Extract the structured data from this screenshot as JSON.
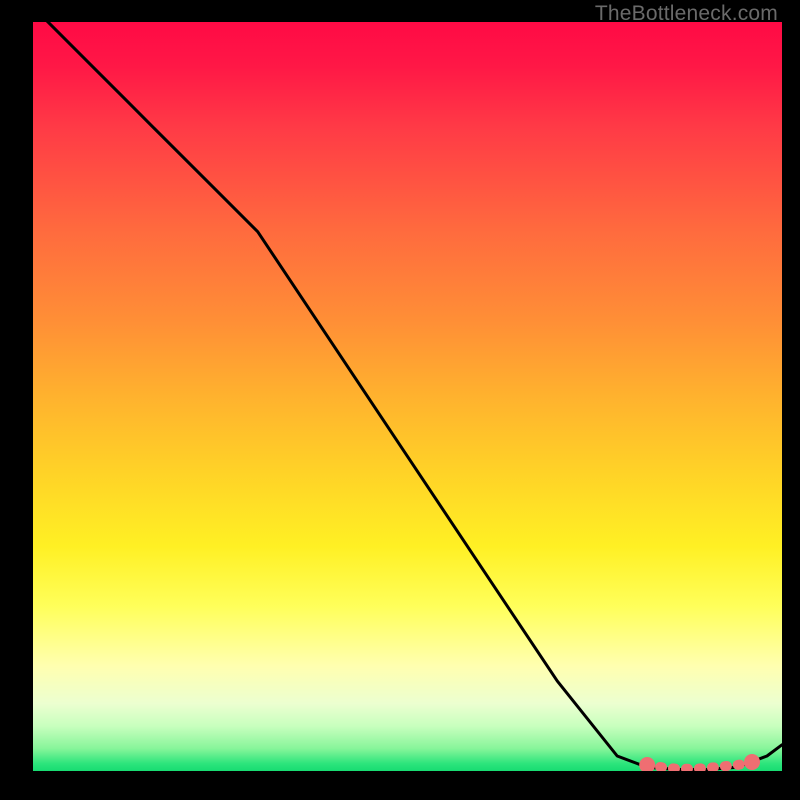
{
  "watermark": "TheBottleneck.com",
  "chart_data": {
    "type": "line",
    "title": "",
    "xlabel": "",
    "ylabel": "",
    "xlim": [
      0,
      100
    ],
    "ylim": [
      0,
      100
    ],
    "grid": false,
    "series": [
      {
        "name": "curve",
        "x": [
          0,
          8,
          16,
          24,
          30,
          40,
          50,
          60,
          70,
          78,
          82,
          86,
          90,
          94,
          98,
          100
        ],
        "y": [
          102,
          94,
          86,
          78,
          72,
          57,
          42,
          27,
          12,
          2,
          0.5,
          0.2,
          0.2,
          0.5,
          2,
          3.5
        ],
        "color": "#000000"
      }
    ],
    "markers": [
      {
        "name": "valley-left-end",
        "x": 82,
        "y": 0.8,
        "color": "#ef6e72"
      },
      {
        "name": "valley-right-end",
        "x": 96,
        "y": 1.2,
        "color": "#ef6e72"
      }
    ],
    "highlight_segment": {
      "name": "valley-region",
      "x": [
        82,
        84,
        86,
        88,
        90,
        92,
        94,
        96
      ],
      "y": [
        0.8,
        0.5,
        0.3,
        0.3,
        0.4,
        0.6,
        0.8,
        1.1
      ],
      "color": "#ef6e72"
    },
    "background": {
      "type": "vertical-gradient",
      "stops": [
        {
          "pos": 0,
          "color": "#ff0a45"
        },
        {
          "pos": 50,
          "color": "#ffb22e"
        },
        {
          "pos": 78,
          "color": "#ffff5a"
        },
        {
          "pos": 97,
          "color": "#87f59a"
        },
        {
          "pos": 100,
          "color": "#17dc72"
        }
      ]
    }
  }
}
